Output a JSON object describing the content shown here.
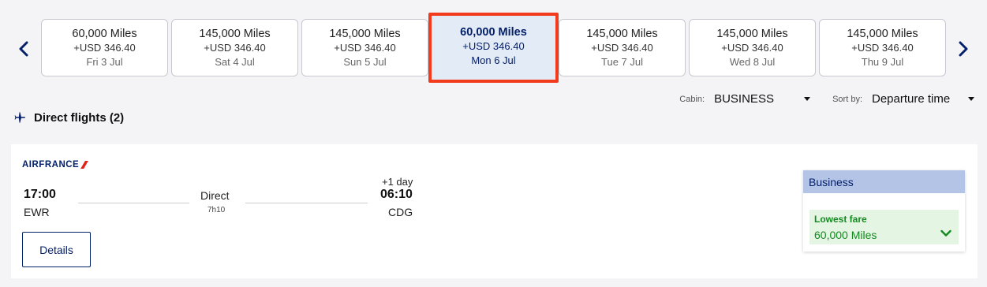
{
  "dates": [
    {
      "miles": "60,000 Miles",
      "usd": "+USD 346.40",
      "date": "Fri 3 Jul"
    },
    {
      "miles": "145,000 Miles",
      "usd": "+USD 346.40",
      "date": "Sat 4 Jul"
    },
    {
      "miles": "145,000 Miles",
      "usd": "+USD 346.40",
      "date": "Sun 5 Jul"
    },
    {
      "miles": "60,000 Miles",
      "usd": "+USD 346.40",
      "date": "Mon 6 Jul"
    },
    {
      "miles": "145,000 Miles",
      "usd": "+USD 346.40",
      "date": "Tue 7 Jul"
    },
    {
      "miles": "145,000 Miles",
      "usd": "+USD 346.40",
      "date": "Wed 8 Jul"
    },
    {
      "miles": "145,000 Miles",
      "usd": "+USD 346.40",
      "date": "Thu 9 Jul"
    }
  ],
  "selected_index": 3,
  "cabin": {
    "label": "Cabin:",
    "value": "BUSINESS"
  },
  "sort": {
    "label": "Sort by:",
    "value": "Departure time"
  },
  "section": {
    "title": "Direct flights (2)"
  },
  "flight": {
    "airline": "AIRFRANCE",
    "dep_time": "17:00",
    "dep_code": "EWR",
    "arr_day": "+1 day",
    "arr_time": "06:10",
    "arr_code": "CDG",
    "stops": "Direct",
    "duration": "7h10",
    "details_label": "Details",
    "fare": {
      "cabin": "Business",
      "label": "Lowest fare",
      "value": "60,000 Miles"
    }
  },
  "colors": {
    "brand": "#05206b",
    "selected_border": "#f23a1c",
    "fare_green": "#138a1f"
  },
  "icons": {
    "prev": "chevron-left-icon",
    "next": "chevron-right-icon",
    "flight": "airplane-icon",
    "fare": "chevron-down-icon"
  }
}
